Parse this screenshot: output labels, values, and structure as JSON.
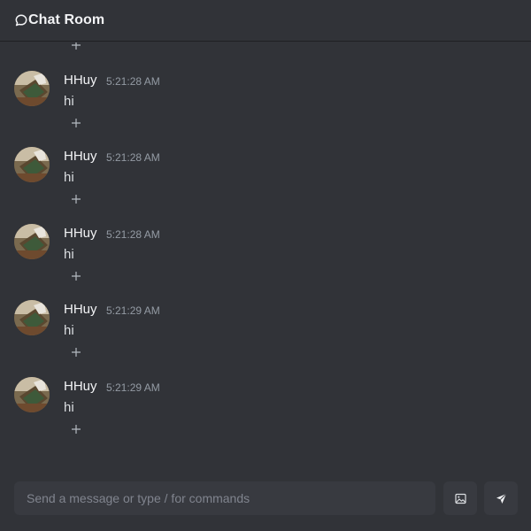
{
  "header": {
    "title": "Chat Room",
    "icon": "chat-bubble-icon"
  },
  "messages": [
    {
      "author": "HHuy",
      "time": "5:21:28 AM",
      "text": "hi"
    },
    {
      "author": "HHuy",
      "time": "5:21:28 AM",
      "text": "hi"
    },
    {
      "author": "HHuy",
      "time": "5:21:28 AM",
      "text": "hi"
    },
    {
      "author": "HHuy",
      "time": "5:21:29 AM",
      "text": "hi"
    },
    {
      "author": "HHuy",
      "time": "5:21:29 AM",
      "text": "hi"
    }
  ],
  "composer": {
    "placeholder": "Send a message or type / for commands",
    "value": ""
  },
  "buttons": {
    "image_icon": "image-icon",
    "send_icon": "send-icon",
    "add_reaction_icon": "plus-icon"
  },
  "colors": {
    "background": "#313338",
    "input_bg": "#383a40",
    "text": "#dbdee1",
    "muted": "#949ba4"
  }
}
